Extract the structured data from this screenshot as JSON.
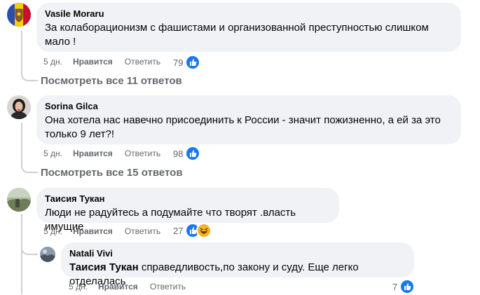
{
  "comments": [
    {
      "author": "Vasile Moraru",
      "text": "За колаборационизм с фашистами и организованной преступностью слишком мало !",
      "time": "5 дн.",
      "like": "Нравится",
      "reply": "Ответить",
      "reactions": "79",
      "view_replies": "Посмотреть все 11 ответов"
    },
    {
      "author": "Sorina Gilca",
      "text": "Она хотела нас навечно присоединить к России - значит пожизненно, а ей за это только 9 лет?!",
      "time": "5 дн.",
      "like": "Нравится",
      "reply": "Ответить",
      "reactions": "98",
      "view_replies": "Посмотреть все 15 ответов"
    },
    {
      "author": "Таисия Тукан",
      "text": "Люди не радуйтесь а подумайте что творят .власть имущие",
      "time": "5 дн.",
      "like": "Нравится",
      "reply": "Ответить",
      "reactions": "27"
    }
  ],
  "reply": {
    "author": "Natali Vivi",
    "mention": "Таисия Тукан",
    "text": " справедливость,по закону и суду. Еще легко отделалась",
    "time": "5 дн.",
    "like": "Нравится",
    "reply": "Ответить",
    "reactions": "7"
  },
  "colors": {
    "bubble": "#f0f2f5",
    "meta": "#65676b",
    "like_blue": "#1877f2",
    "haha_yellow": "#f7b125"
  },
  "icons": [
    "thumbs-up-icon",
    "haha-icon"
  ]
}
